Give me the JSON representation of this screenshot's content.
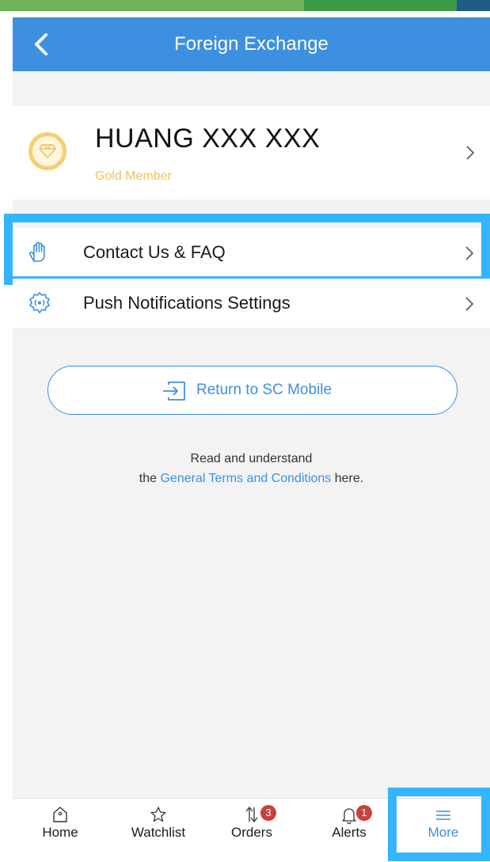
{
  "header": {
    "title": "Foreign Exchange"
  },
  "profile": {
    "name": "HUANG XXX XXX",
    "tier": "Gold Member"
  },
  "menu": {
    "items": [
      {
        "label": "Contact Us & FAQ"
      },
      {
        "label": "Push Notifications Settings"
      }
    ]
  },
  "return_button": {
    "label": "Return to SC Mobile"
  },
  "terms": {
    "line1": "Read and understand",
    "prefix": "the ",
    "link": "General Terms and Conditions",
    "suffix": " here."
  },
  "tabs": [
    {
      "label": "Home"
    },
    {
      "label": "Watchlist"
    },
    {
      "label": "Orders",
      "badge": "3"
    },
    {
      "label": "Alerts",
      "badge": "1"
    },
    {
      "label": "More"
    }
  ],
  "colors": {
    "accent": "#3d8fe0",
    "highlight": "#33b5ff",
    "gold": "#f0c15a",
    "badge": "#c9413d"
  },
  "icons": [
    "back-arrow-icon",
    "diamond-icon",
    "chevron-right-icon",
    "hand-icon",
    "gear-icon",
    "exit-icon",
    "home-icon",
    "star-icon",
    "sort-arrows-icon",
    "bell-icon",
    "menu-icon"
  ]
}
